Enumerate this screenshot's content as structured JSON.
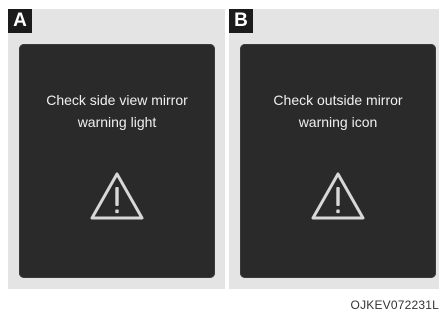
{
  "panels": [
    {
      "letter": "A",
      "line1": "Check side view mirror",
      "line2": "warning light",
      "icon": "warning-triangle-icon"
    },
    {
      "letter": "B",
      "line1": "Check outside mirror",
      "line2": "warning icon",
      "icon": "warning-triangle-icon"
    }
  ],
  "image_code": "OJKEV072231L",
  "colors": {
    "screen": "#2a2a2a",
    "panel_background": "#e4e4e4",
    "text": "#efefef",
    "label_background": "#1b1b1b"
  }
}
